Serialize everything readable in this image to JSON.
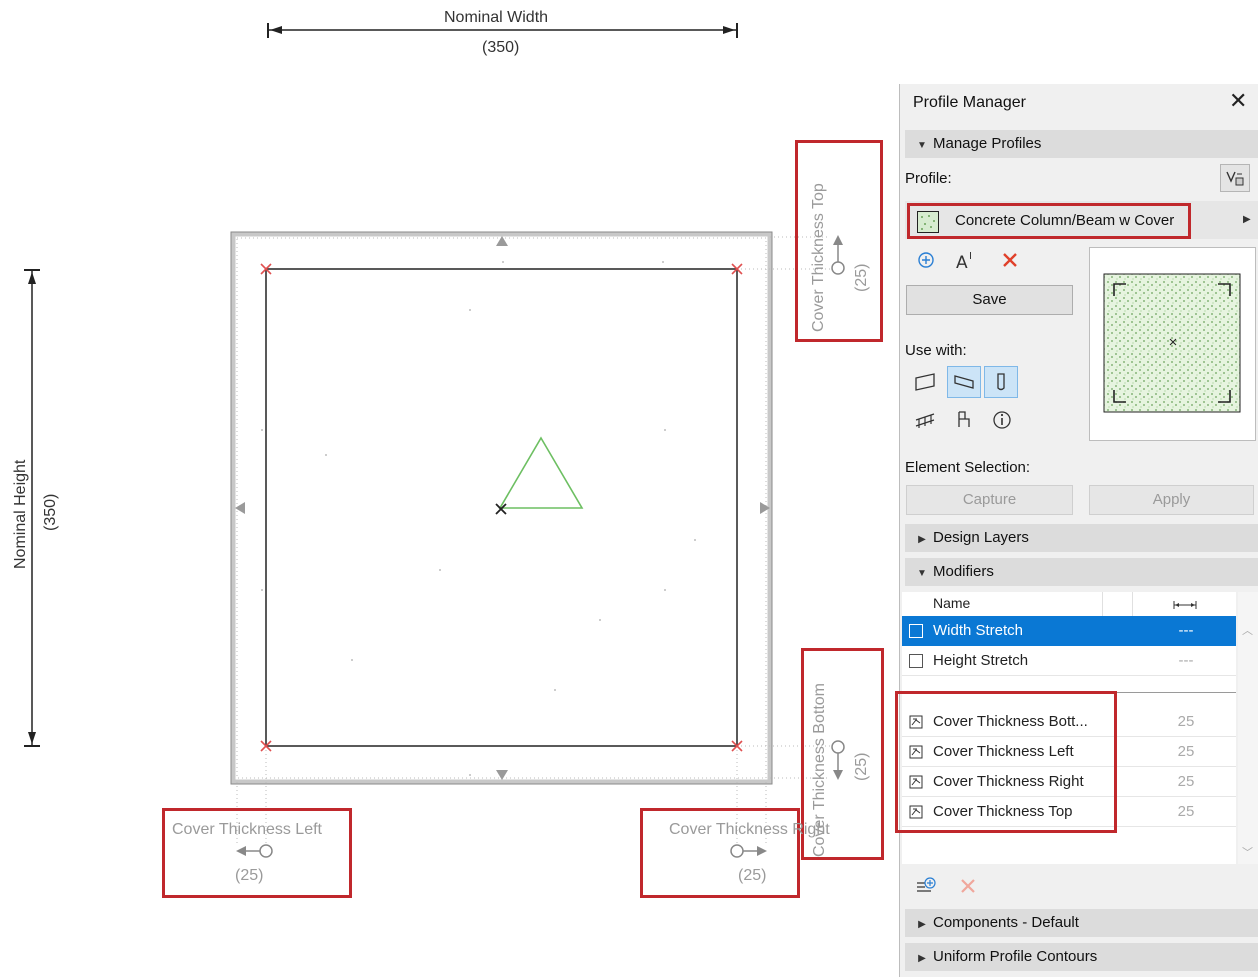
{
  "canvas": {
    "nominal_width_label": "Nominal Width",
    "nominal_width_value": "(350)",
    "nominal_height_label": "Nominal Height",
    "nominal_height_value": "(350)",
    "cover_top_label": "Cover Thickness Top",
    "cover_top_value": "(25)",
    "cover_bottom_label": "Cover Thickness Bottom",
    "cover_bottom_value": "(25)",
    "cover_left_label": "Cover Thickness Left",
    "cover_left_value": "(25)",
    "cover_right_label": "Cover Thickness Right",
    "cover_right_value": "(25)"
  },
  "panel": {
    "title": "Profile Manager",
    "close_glyph": "✕",
    "manage_profiles": "Manage Profiles",
    "profile_label": "Profile:",
    "profile_name": "Concrete Column/Beam w Cover",
    "save_label": "Save",
    "use_with_label": "Use with:",
    "element_selection_label": "Element Selection:",
    "capture_label": "Capture",
    "apply_label": "Apply",
    "design_layers": "Design Layers",
    "modifiers": "Modifiers",
    "table_header_name": "Name",
    "modifiers_rows": [
      {
        "name": "Width Stretch",
        "value": "---"
      },
      {
        "name": "Height Stretch",
        "value": "---"
      }
    ],
    "param_rows": [
      {
        "name": "Cover Thickness Bott...",
        "value": "25"
      },
      {
        "name": "Cover Thickness Left",
        "value": "25"
      },
      {
        "name": "Cover Thickness Right",
        "value": "25"
      },
      {
        "name": "Cover Thickness Top",
        "value": "25"
      }
    ],
    "components": "Components - Default",
    "uniform_contours": "Uniform Profile Contours"
  },
  "colors": {
    "highlight_red": "#c0282c",
    "selection_blue": "#0a78d4",
    "section_gray": "#dcdcdc"
  }
}
